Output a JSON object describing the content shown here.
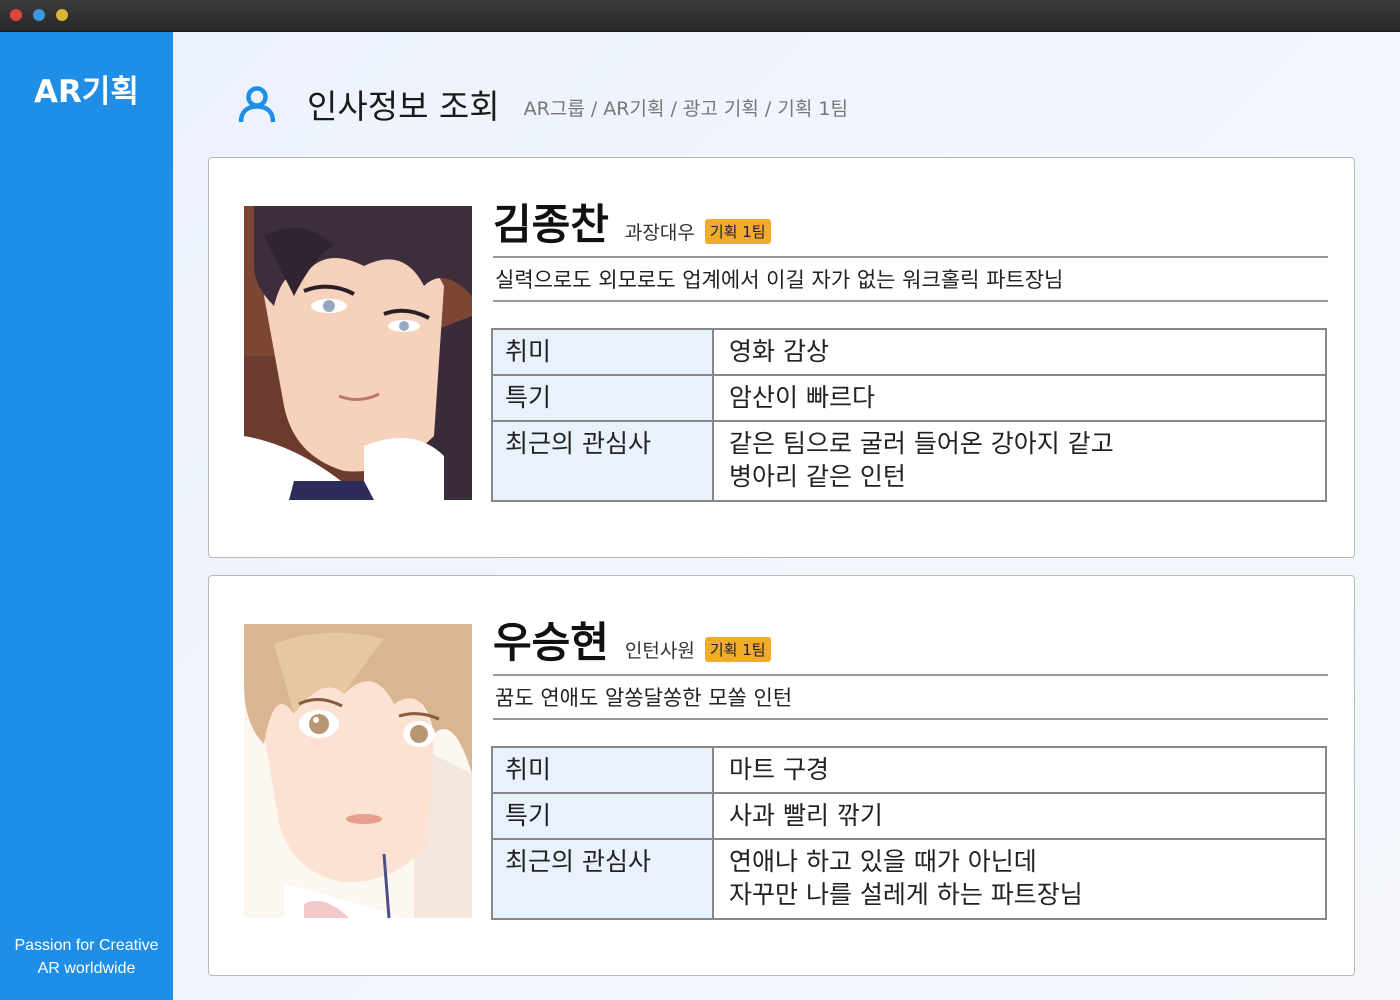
{
  "app": {
    "brand": "AR기획",
    "tagline_line1": "Passion for Creative",
    "tagline_line2": "AR worldwide"
  },
  "header": {
    "title": "인사정보 조회",
    "breadcrumb": "AR그룹 / AR기획 / 광고 기획 / 기획 1팀"
  },
  "labels": {
    "hobby": "취미",
    "skill": "특기",
    "interest": "최근의 관심사"
  },
  "employees": [
    {
      "name": "김종찬",
      "rank": "과장대우",
      "team": "기획 1팀",
      "description": "실력으로도 외모로도 업계에서 이길 자가 없는 워크홀릭 파트장님",
      "hobby": "영화 감상",
      "skill": "암산이 빠르다",
      "interest_line1": "같은 팀으로 굴러 들어온 강아지 같고",
      "interest_line2": "병아리 같은 인턴"
    },
    {
      "name": "우승현",
      "rank": "인턴사원",
      "team": "기획 1팀",
      "description": "꿈도 연애도 알쏭달쏭한 모쏠 인턴",
      "hobby": "마트 구경",
      "skill": "사과 빨리 깎기",
      "interest_line1": "연애나 하고 있을 때가 아닌데",
      "interest_line2": "자꾸만 나를 설레게 하는 파트장님"
    }
  ],
  "colors": {
    "sidebar": "#1e8ee6",
    "badge": "#f0ab2a",
    "table_key_bg": "#e9f1fc"
  }
}
